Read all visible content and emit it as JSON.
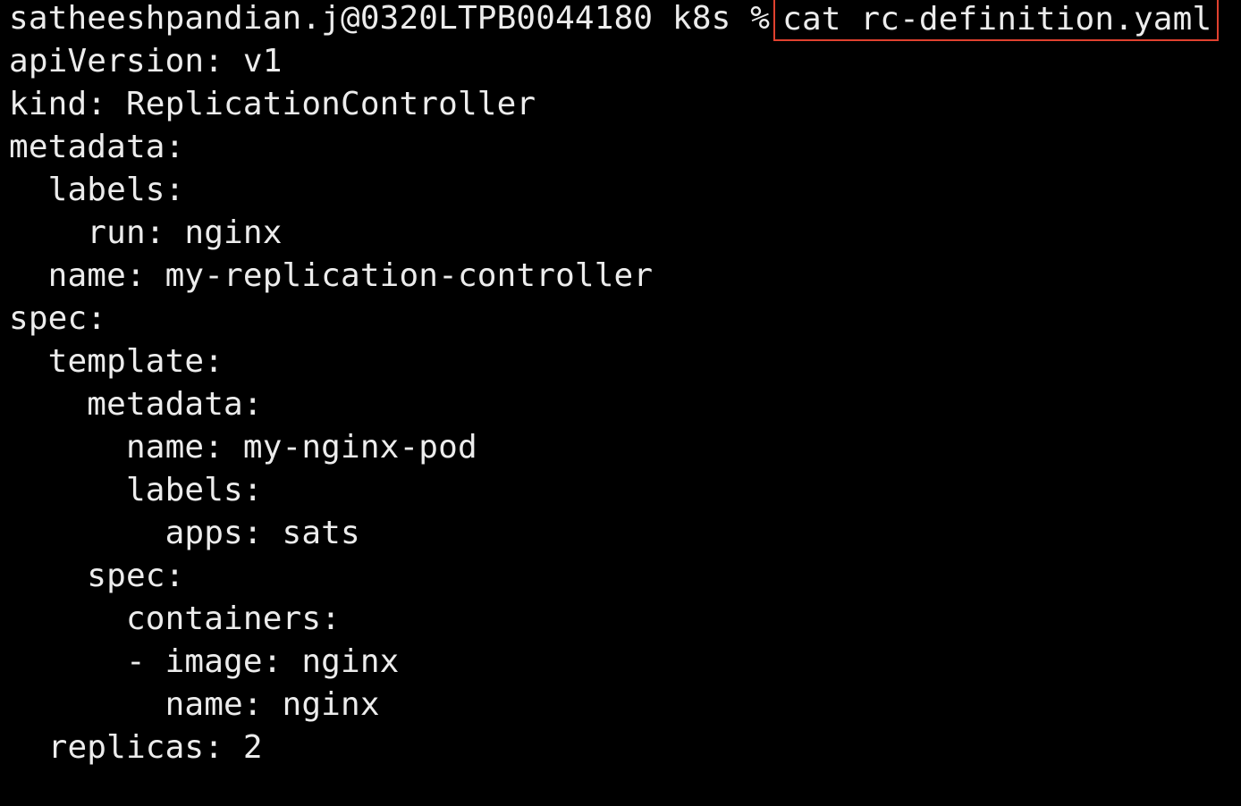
{
  "terminal": {
    "prompt": "satheeshpandian.j@0320LTPB0044180 k8s %",
    "command": "cat rc-definition.yaml",
    "highlight_color": "#e0412f",
    "output_lines": [
      "apiVersion: v1",
      "kind: ReplicationController",
      "metadata:",
      "  labels:",
      "    run: nginx",
      "  name: my-replication-controller",
      "spec:",
      "  template:",
      "    metadata:",
      "      name: my-nginx-pod",
      "      labels:",
      "        apps: sats",
      "    spec:",
      "      containers:",
      "      - image: nginx",
      "        name: nginx",
      "  replicas: 2"
    ]
  }
}
